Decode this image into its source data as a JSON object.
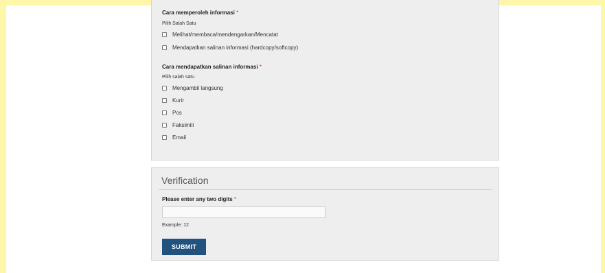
{
  "info_method": {
    "label": "Cara memperoleh informasi",
    "required_mark": "*",
    "hint": "Pilih Salah Satu",
    "options": [
      "Melihat/membaca/mendengarkan/Mencatat",
      "Mendapatkan salinan informasi (hardcopy/softcopy)"
    ]
  },
  "copy_method": {
    "label": "Cara mendapatkan salinan informasi",
    "required_mark": "*",
    "hint": "Pilih salah satu",
    "options": [
      "Mengambil langsung",
      "Kurir",
      "Pos",
      "Faksimili",
      "Email"
    ]
  },
  "verification": {
    "title": "Verification",
    "field_label": "Please enter any two digits",
    "required_mark": "*",
    "input_value": "",
    "example": "Example: 12",
    "submit_label": "SUBMIT"
  },
  "colors": {
    "frame": "#fef6a8",
    "panel_bg": "#eeeeee",
    "button_bg": "#22527e",
    "required": "#c0392b"
  }
}
